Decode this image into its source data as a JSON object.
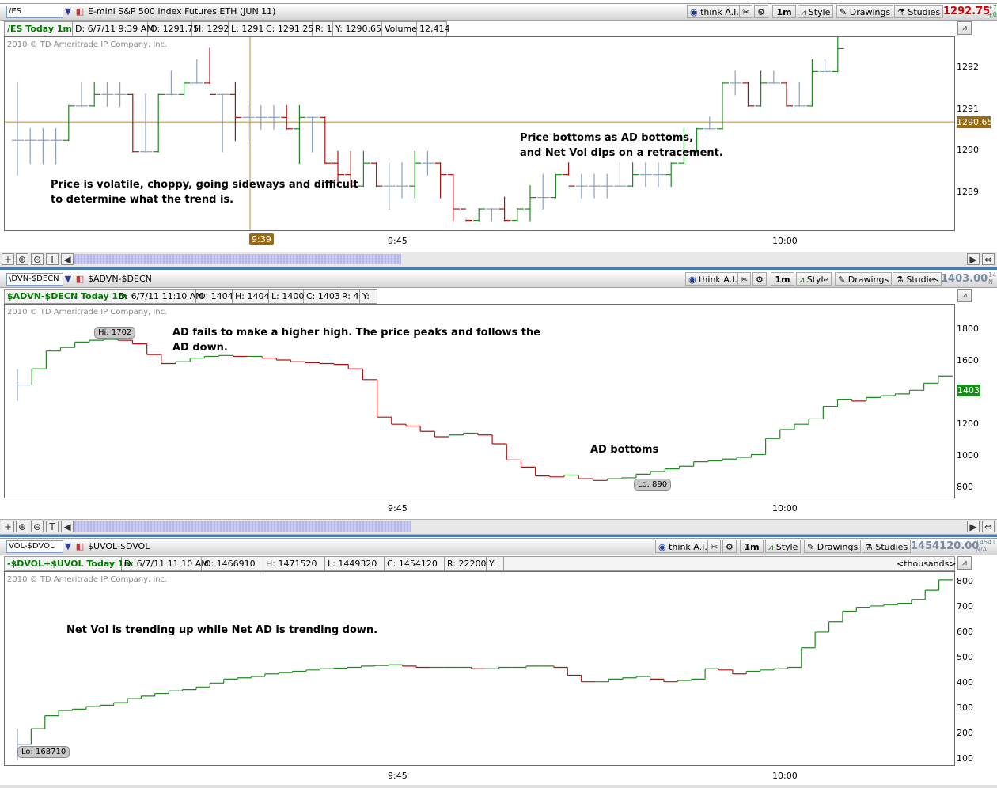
{
  "panels": [
    {
      "symbol": "/ES",
      "description": "E-mini S&P 500 Index Futures,ETH (JUN 11)",
      "last": "1292.75",
      "last_color": "#d00000",
      "last_side_top": "+7",
      "last_side_bot": "+0",
      "toolbar": {
        "think": "think A.I.",
        "interval": "1m",
        "style": "Style",
        "drawings": "Drawings",
        "studies": "Studies"
      },
      "info": {
        "name": "/ES Today 1m",
        "date": "D: 6/7/11 9:39 AM",
        "open": "O: 1291.75",
        "high": "H: 1292",
        "low": "L: 1291",
        "close": "C: 1291.25",
        "range": "R: 1",
        "y": "Y: 1290.65",
        "volume_label": "Volume",
        "volume": "12,414"
      },
      "copyright": "2010 © TD Ameritrade IP Company, Inc.",
      "annotations": [
        {
          "line1": "Price is volatile, choppy, going sideways and difficult",
          "line2": "to determine what the trend is."
        },
        {
          "line1": "Price bottoms as AD bottoms,",
          "line2": "and Net Vol dips on a retracement."
        }
      ],
      "yticks": [
        "1292",
        "1291",
        "1290",
        "1289"
      ],
      "price_tag": "1290.65",
      "cursor_time": "9:39",
      "xlabels": [
        "9:45",
        "10:00"
      ]
    },
    {
      "symbol": "$ADVN-$DECN",
      "symbol_display": "\\DVN-$DECN",
      "description": "$ADVN-$DECN",
      "last": "1403.00",
      "last_color": "#7a8aa0",
      "last_side_top": "14",
      "last_side_bot": "N",
      "toolbar": {
        "think": "think A.I.",
        "interval": "1m",
        "style": "Style",
        "drawings": "Drawings",
        "studies": "Studies"
      },
      "info": {
        "name": "$ADVN-$DECN Today 1m",
        "date": "D: 6/7/11 11:10 AM",
        "open": "O: 1404",
        "high": "H: 1404",
        "low": "L: 1400",
        "close": "C: 1403",
        "range": "R: 4",
        "y": "Y:"
      },
      "copyright": "2010 © TD Ameritrade IP Company, Inc.",
      "annotations": [
        {
          "line1": "AD fails to make a higher high.  The price peaks and follows the",
          "line2": "AD down."
        },
        {
          "line1": "AD bottoms",
          "line2": ""
        }
      ],
      "hi_label": "Hi: 1702",
      "lo_label": "Lo: 890",
      "yticks": [
        "1800",
        "1600",
        "1400",
        "1200",
        "1000",
        "800"
      ],
      "price_tag": "1403",
      "xlabels": [
        "9:45",
        "10:00"
      ]
    },
    {
      "symbol": "$UVOL-$DVOL",
      "symbol_display": "VOL-$DVOL",
      "description": "$UVOL-$DVOL",
      "last": "1454120.00",
      "last_color": "#7a8aa0",
      "last_side_top": "14541",
      "last_side_bot": "N/A",
      "toolbar": {
        "think": "think A.I.",
        "interval": "1m",
        "style": "Style",
        "drawings": "Drawings",
        "studies": "Studies"
      },
      "info": {
        "name": "-$DVOL+$UVOL Today 1m",
        "date": "D: 6/7/11 11:10 AM",
        "open": "O: 1466910",
        "high": "H: 1471520",
        "low": "L: 1449320",
        "close": "C: 1454120",
        "range": "R: 22200",
        "y": "Y:",
        "units": "<thousands>"
      },
      "copyright": "2010 © TD Ameritrade IP Company, Inc.",
      "annotations": [
        {
          "line1": "Net Vol is trending up while Net AD is trending down.",
          "line2": ""
        }
      ],
      "lo_label": "Lo: 168710",
      "yticks": [
        "800",
        "700",
        "600",
        "500",
        "400",
        "300",
        "200",
        "100"
      ],
      "xlabels": [
        "9:45",
        "10:00"
      ]
    }
  ],
  "colors": {
    "up": "#1f8a1f",
    "down": "#b01010",
    "neutral": "#8aa0c0",
    "crosshair": "#b09030",
    "pricetag": "#9a6a10",
    "adtag": "#1a8a1a"
  },
  "chart_data": [
    {
      "type": "ohlc",
      "title": "/ES Today 1m",
      "ylim": [
        1288.25,
        1292.5
      ],
      "bars": [
        [
          1290.25,
          1291.5,
          1289.5,
          1290.25
        ],
        [
          1290.25,
          1290.5,
          1289.75,
          1290.25
        ],
        [
          1290.25,
          1290.5,
          1289.75,
          1290.25
        ],
        [
          1290.25,
          1290.5,
          1289.75,
          1290.25
        ],
        [
          1290.25,
          1291,
          1290.25,
          1291
        ],
        [
          1291,
          1291.5,
          1291,
          1291
        ],
        [
          1291,
          1291.5,
          1291,
          1291.25
        ],
        [
          1291.25,
          1291.5,
          1291,
          1291.25
        ],
        [
          1291.25,
          1291.5,
          1291,
          1291.25
        ],
        [
          1291.25,
          1291.25,
          1290,
          1290
        ],
        [
          1290,
          1291.25,
          1290,
          1290
        ],
        [
          1290,
          1291.25,
          1290,
          1291.25
        ],
        [
          1291.25,
          1291.75,
          1291.25,
          1291.25
        ],
        [
          1291.25,
          1291.5,
          1291.25,
          1291.5
        ],
        [
          1291.5,
          1292,
          1291.5,
          1291.5
        ],
        [
          1291.5,
          1292.25,
          1291.5,
          1291.25
        ],
        [
          1291.25,
          1291.25,
          1290,
          1291.25
        ],
        [
          1291.25,
          1291.5,
          1290.25,
          1290.75
        ],
        [
          1290.75,
          1291,
          1290.25,
          1290.75
        ],
        [
          1290.75,
          1291,
          1290.5,
          1290.75
        ],
        [
          1290.75,
          1291,
          1290.5,
          1290.75
        ],
        [
          1290.75,
          1291,
          1290.5,
          1290.5
        ],
        [
          1290.5,
          1291,
          1289.75,
          1290.75
        ],
        [
          1290.75,
          1290.75,
          1290,
          1290.75
        ],
        [
          1290.75,
          1290.75,
          1289.75,
          1289.75
        ],
        [
          1289.75,
          1290,
          1289.25,
          1289.5
        ],
        [
          1289.5,
          1290,
          1289.25,
          1289.25
        ],
        [
          1289.25,
          1290,
          1289.25,
          1289.75
        ],
        [
          1289.75,
          1289.75,
          1289.25,
          1289.25
        ],
        [
          1289.25,
          1289.75,
          1288.75,
          1289.25
        ],
        [
          1289.25,
          1289.75,
          1289,
          1289.25
        ],
        [
          1289.25,
          1290,
          1289,
          1289.75
        ],
        [
          1289.75,
          1290,
          1289.5,
          1289.75
        ],
        [
          1289.75,
          1289.75,
          1289,
          1289.5
        ],
        [
          1289.5,
          1289.5,
          1288.5,
          1288.75
        ],
        [
          1288.75,
          1288.5,
          1288.5,
          1288.5
        ],
        [
          1288.5,
          1288.75,
          1288.5,
          1288.75
        ],
        [
          1288.75,
          1288.75,
          1288.5,
          1288.75
        ],
        [
          1288.75,
          1289,
          1288.5,
          1288.5
        ],
        [
          1288.5,
          1288.75,
          1288.5,
          1288.75
        ],
        [
          1288.75,
          1289.25,
          1288.5,
          1289
        ],
        [
          1289,
          1289.5,
          1288.75,
          1289
        ],
        [
          1289,
          1289.5,
          1289,
          1289.5
        ],
        [
          1289.5,
          1289.75,
          1289.5,
          1289.25
        ],
        [
          1289.25,
          1289.5,
          1289,
          1289.25
        ],
        [
          1289.25,
          1289.5,
          1289,
          1289.25
        ],
        [
          1289.25,
          1289.5,
          1289,
          1289.25
        ],
        [
          1289.25,
          1289.75,
          1289.25,
          1289.25
        ],
        [
          1289.25,
          1289.75,
          1289.25,
          1289.5
        ],
        [
          1289.5,
          1289.75,
          1289.25,
          1289.5
        ],
        [
          1289.5,
          1289.75,
          1289.25,
          1289.5
        ],
        [
          1289.5,
          1289.75,
          1289.25,
          1289.75
        ],
        [
          1289.75,
          1290.5,
          1289.75,
          1290
        ],
        [
          1290,
          1290.5,
          1290,
          1290.5
        ],
        [
          1290.5,
          1290.75,
          1290.5,
          1290.5
        ],
        [
          1290.5,
          1291.5,
          1290.5,
          1291.5
        ],
        [
          1291.5,
          1291.75,
          1291.25,
          1291.5
        ],
        [
          1291.5,
          1291.5,
          1291,
          1291
        ],
        [
          1291,
          1291.75,
          1291,
          1291.5
        ],
        [
          1291.5,
          1291.75,
          1291.5,
          1291.5
        ],
        [
          1291.5,
          1291.5,
          1291,
          1291
        ],
        [
          1291,
          1291.5,
          1291,
          1291
        ],
        [
          1291,
          1292,
          1291,
          1291.75
        ],
        [
          1291.75,
          1292,
          1291.75,
          1291.75
        ],
        [
          1291.75,
          1292.5,
          1291.75,
          1292.25
        ]
      ]
    },
    {
      "type": "step",
      "title": "$ADVN-$DECN Today 1m",
      "ylim": [
        790,
        1880
      ],
      "values": [
        1430,
        1520,
        1620,
        1640,
        1670,
        1680,
        1685,
        1680,
        1660,
        1600,
        1550,
        1560,
        1580,
        1590,
        1595,
        1590,
        1590,
        1580,
        1570,
        1560,
        1555,
        1550,
        1545,
        1520,
        1460,
        1250,
        1210,
        1200,
        1170,
        1140,
        1150,
        1160,
        1150,
        1100,
        1010,
        970,
        920,
        915,
        925,
        905,
        895,
        905,
        910,
        930,
        945,
        960,
        975,
        1000,
        1005,
        1015,
        1025,
        1040,
        1130,
        1180,
        1210,
        1240,
        1310,
        1350,
        1340,
        1360,
        1370,
        1380,
        1400,
        1440,
        1480
      ]
    },
    {
      "type": "step",
      "title": "-$DVOL+$UVOL Today 1m",
      "units": "<thousands>",
      "ylim": [
        85,
        830
      ],
      "values": [
        170,
        230,
        280,
        300,
        305,
        315,
        320,
        330,
        345,
        355,
        365,
        375,
        380,
        390,
        405,
        420,
        425,
        430,
        440,
        445,
        450,
        455,
        460,
        462,
        465,
        470,
        472,
        475,
        470,
        465,
        465,
        465,
        465,
        460,
        460,
        465,
        465,
        470,
        470,
        465,
        435,
        410,
        410,
        420,
        425,
        430,
        420,
        410,
        415,
        420,
        460,
        455,
        440,
        450,
        455,
        460,
        465,
        540,
        600,
        640,
        680,
        695,
        700,
        705,
        710,
        725,
        760,
        800
      ]
    }
  ]
}
